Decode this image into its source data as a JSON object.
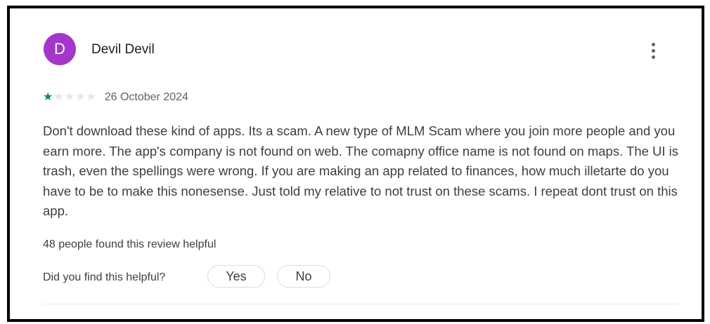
{
  "review": {
    "avatar_letter": "D",
    "author": "Devil Devil",
    "rating": 1,
    "max_rating": 5,
    "date": "26 October 2024",
    "text": "Don't download these kind of apps. Its a scam. A new type of MLM Scam where you join more people and you earn more. The app's company is not found on web. The comapny office name is not found on maps. The UI is trash, even the spellings were wrong. If you are making an app related to finances, how much illetarte do you have to be to make this nonesense. Just told my relative to not trust on these scams. I repeat dont trust on this app.",
    "helpful_count": "48 people found this review helpful",
    "helpful_question": "Did you find this helpful?",
    "yes_label": "Yes",
    "no_label": "No"
  },
  "icons": {
    "more": "more-vert-icon",
    "star": "star-icon"
  },
  "colors": {
    "avatar": "#a437c9",
    "star_filled": "#01875f",
    "star_empty": "#e3e5e8",
    "text": "#3c4043"
  }
}
